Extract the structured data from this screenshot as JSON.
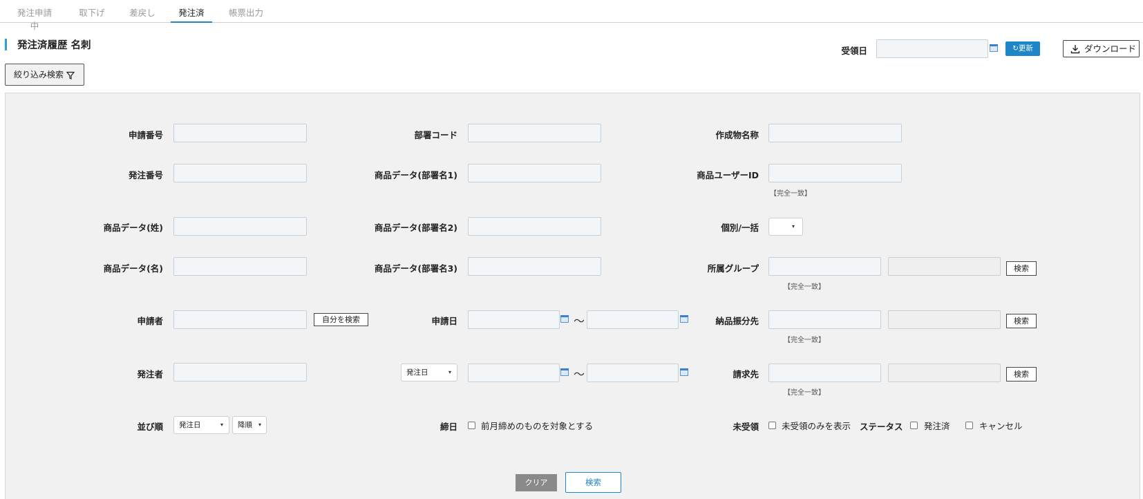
{
  "tabs": [
    {
      "label": "発注申請中"
    },
    {
      "label": "取下げ"
    },
    {
      "label": "差戻し"
    },
    {
      "label": "発注済"
    },
    {
      "label": "帳票出力"
    }
  ],
  "page": {
    "title": "発注済履歴 名刺"
  },
  "header": {
    "received_date_label": "受領日",
    "received_date_value": "",
    "refresh_label": "更新",
    "download_label": "ダウンロード"
  },
  "filter": {
    "toggle_label": "絞り込み検索"
  },
  "form": {
    "application_no": {
      "label": "申請番号",
      "value": ""
    },
    "order_no": {
      "label": "発注番号",
      "value": ""
    },
    "last_name": {
      "label": "商品データ(姓)",
      "value": ""
    },
    "first_name": {
      "label": "商品データ(名)",
      "value": ""
    },
    "applicant": {
      "label": "申請者",
      "value": "",
      "self_search_label": "自分を検索"
    },
    "orderer": {
      "label": "発注者",
      "value": ""
    },
    "sort": {
      "label": "並び順",
      "field_value": "発注日",
      "order_value": "降順"
    },
    "dept_code": {
      "label": "部署コード",
      "value": ""
    },
    "dept1": {
      "label": "商品データ(部署名1)",
      "value": ""
    },
    "dept2": {
      "label": "商品データ(部署名2)",
      "value": ""
    },
    "dept3": {
      "label": "商品データ(部署名3)",
      "value": ""
    },
    "application_date": {
      "label": "申請日",
      "from": "",
      "to": "",
      "separator": "〜"
    },
    "date_type": {
      "value": "発注日",
      "from": "",
      "to": "",
      "separator": "〜"
    },
    "closing": {
      "label": "締日",
      "checkbox_label": "前月締めのものを対象とする",
      "checked": false
    },
    "product_name": {
      "label": "作成物名称",
      "value": ""
    },
    "user_id": {
      "label": "商品ユーザーID",
      "value": "",
      "note": "【完全一致】"
    },
    "individual_bulk": {
      "label": "個別/一括",
      "value": ""
    },
    "group": {
      "label": "所属グループ",
      "code": "",
      "name": "",
      "search_label": "検索",
      "note": "【完全一致】"
    },
    "delivery": {
      "label": "納品振分先",
      "code": "",
      "name": "",
      "search_label": "検索",
      "note": "【完全一致】"
    },
    "billing": {
      "label": "請求先",
      "code": "",
      "name": "",
      "search_label": "検索",
      "note": "【完全一致】"
    },
    "unreceived": {
      "label": "未受領",
      "checkbox_label": "未受領のみを表示",
      "checked": false
    },
    "status": {
      "label": "ステータス",
      "options": [
        {
          "label": "発注済",
          "checked": false
        },
        {
          "label": "キャンセル",
          "checked": false
        }
      ]
    }
  },
  "actions": {
    "clear_label": "クリア",
    "search_label": "検索"
  },
  "colors": {
    "accent": "#1d86c9",
    "title_bar": "#2aa3dc",
    "panel_bg": "#f1f1f1",
    "clear_button": "#8a8a8a"
  }
}
